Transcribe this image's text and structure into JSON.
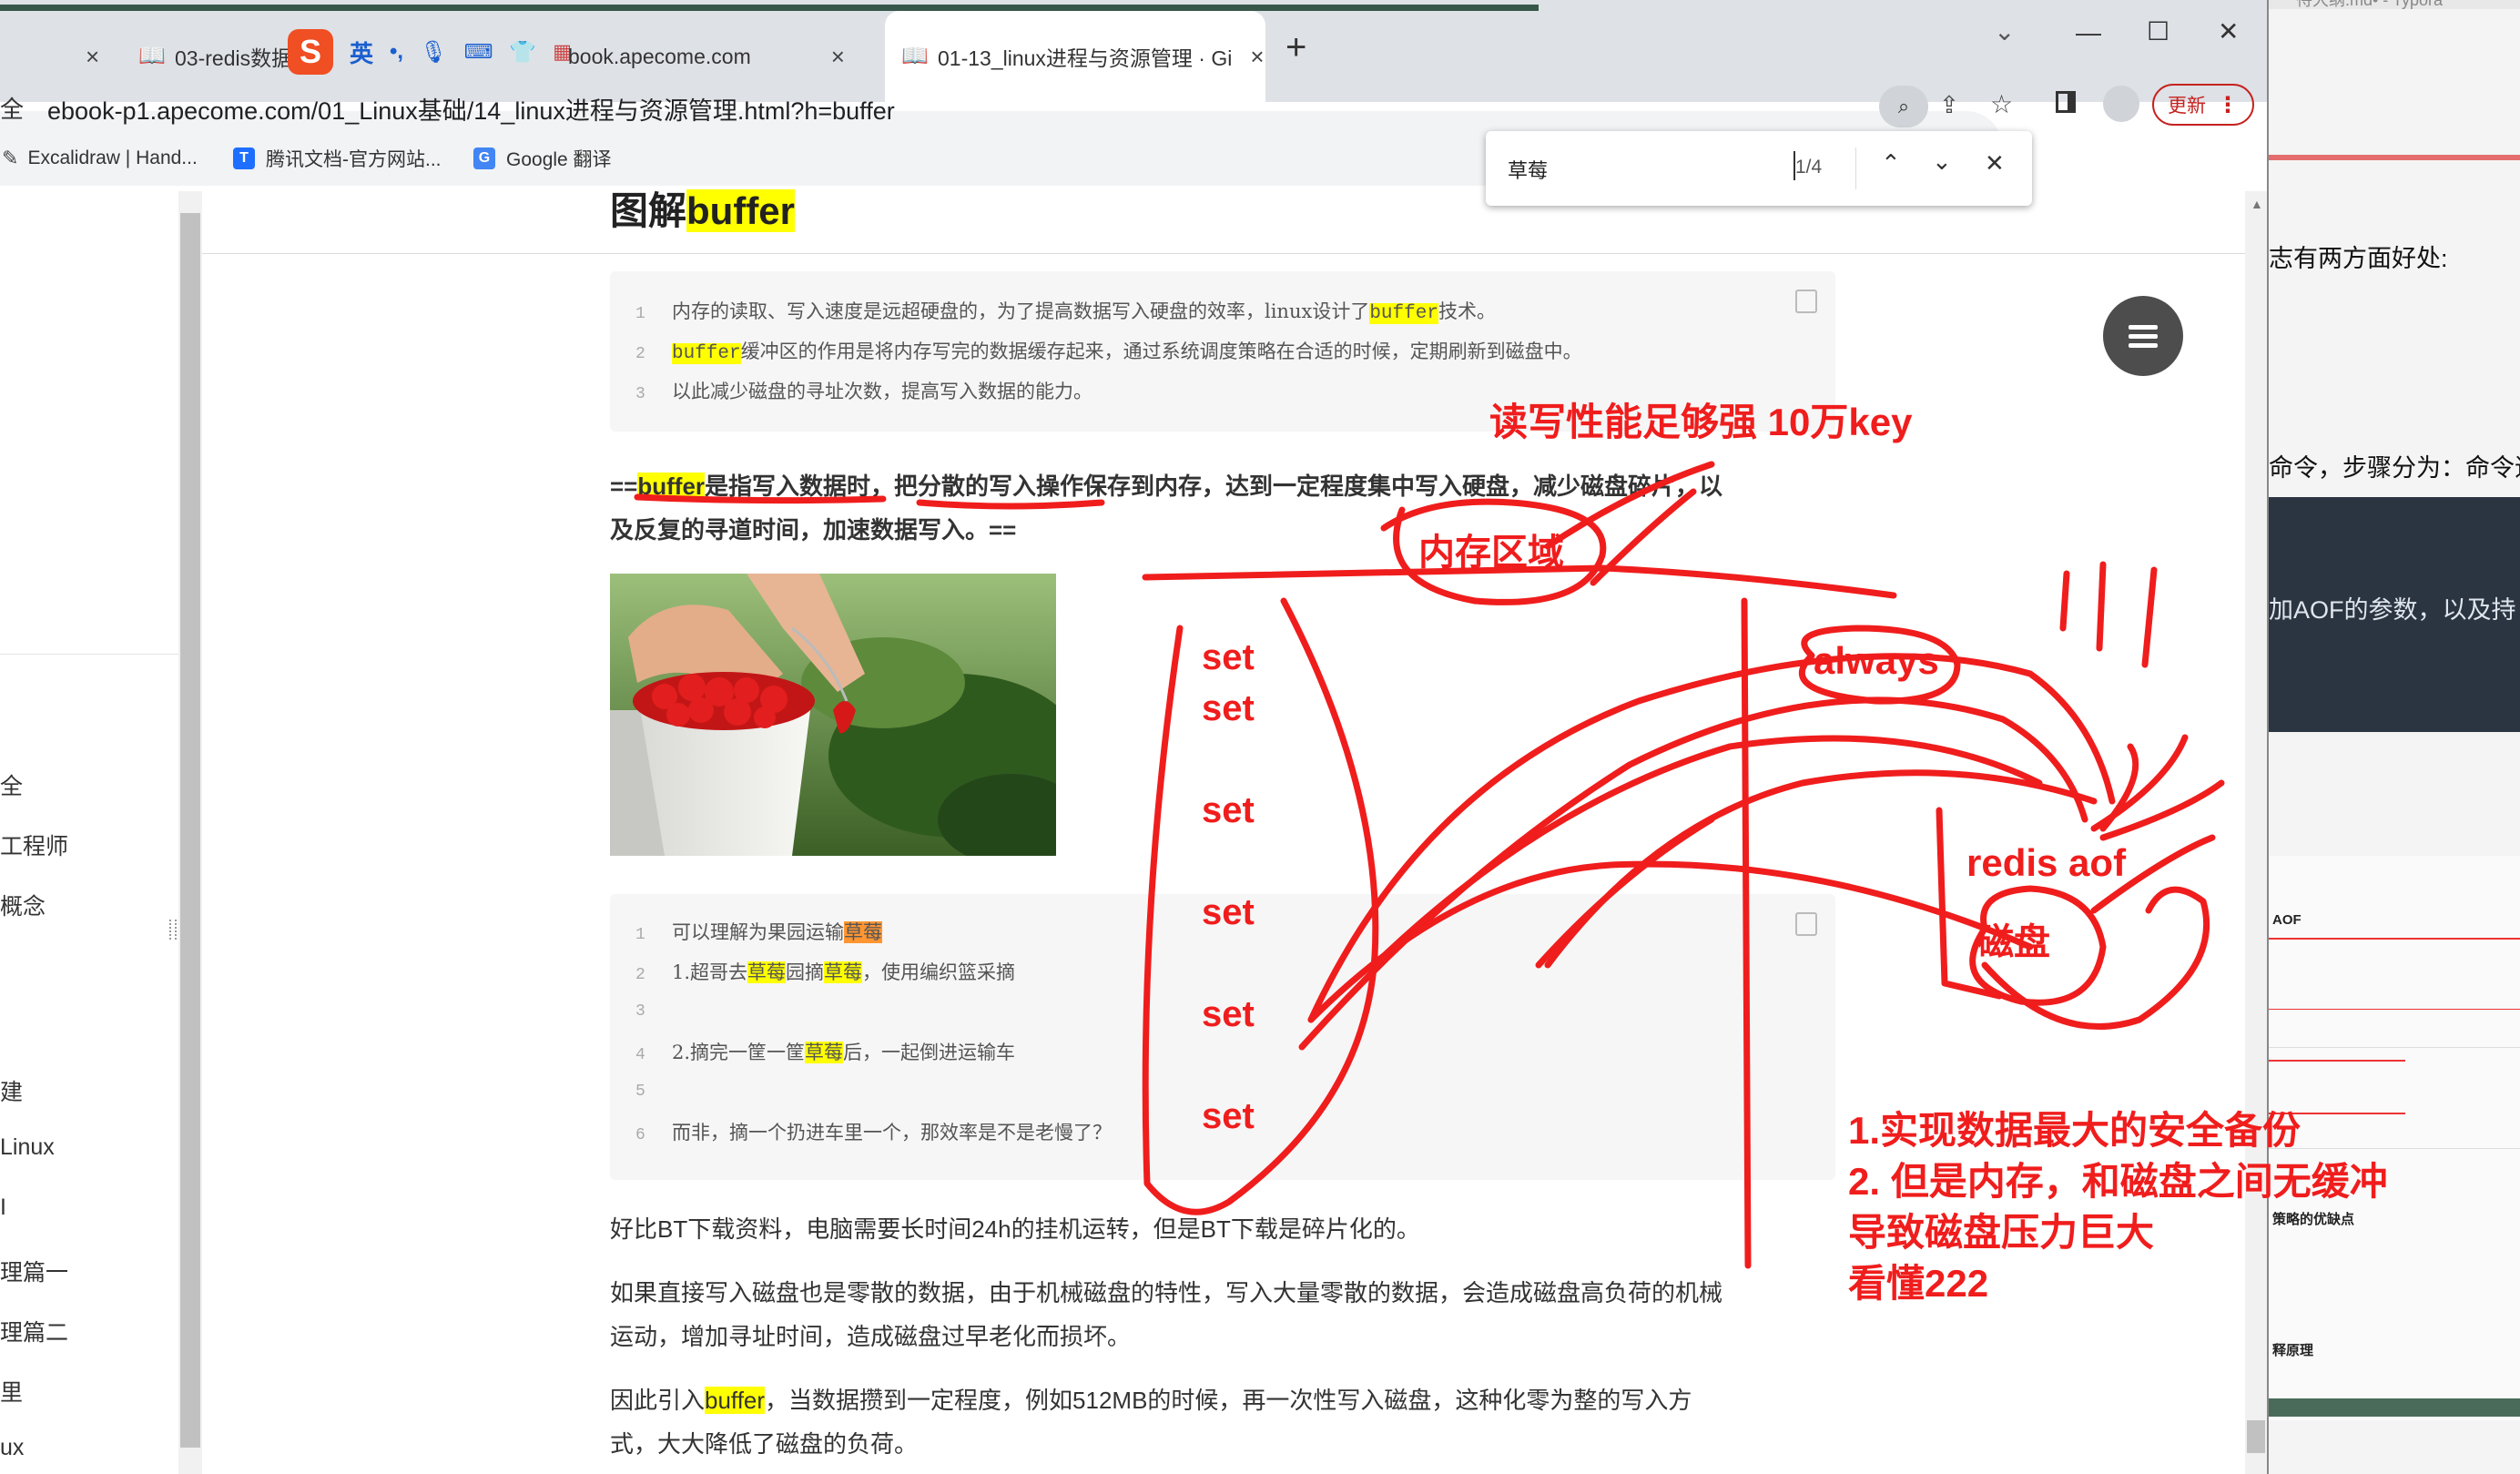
{
  "tabs": [
    {
      "title": "03-redis数据",
      "close": "×"
    },
    {
      "title": "book.apecome.com",
      "close": "×"
    },
    {
      "title": "01-13_linux进程与资源管理 · Gi",
      "close": "×"
    }
  ],
  "left_edge_tab_close": "×",
  "new_tab": "+",
  "ime": {
    "sogou": "S",
    "lang": "英",
    "punct": "•,"
  },
  "window_controls": {
    "dropdown": "⌄",
    "minimize": "—",
    "maximize": "☐",
    "close": "✕"
  },
  "address": {
    "prefix": "全",
    "url": "ebook-p1.apecome.com/01_Linux基础/14_linux进程与资源管理.html?h=buffer"
  },
  "update_button": "更新",
  "bookmarks": [
    "Excalidraw | Hand...",
    "腾讯文档-官方网站...",
    "Google 翻译"
  ],
  "find": {
    "query": "草莓",
    "count": "1/4"
  },
  "sidebar_items": [
    "全",
    "工程师",
    "概念",
    "建",
    "Linux",
    "I",
    "理篇一",
    "理篇二",
    "里",
    "ux"
  ],
  "article": {
    "title_plain": "图解",
    "title_hl": "buffer",
    "code1": [
      {
        "n": "1",
        "pre": "内存的读取、写入速度是远超硬盘的，为了提高数据写入硬盘的效率，linux设计了",
        "hl": "buffer",
        "post": "技术。"
      },
      {
        "n": "2",
        "pre": "",
        "hl": "buffer",
        "post": "缓冲区的作用是将内存写完的数据缓存起来，通过系统调度策略在合适的时候，定期刷新到磁盘中。"
      },
      {
        "n": "3",
        "pre": "以此减少磁盘的寻址次数，提高写入数据的能力。",
        "hl": "",
        "post": ""
      }
    ],
    "bold_para": {
      "line1_pre": "==",
      "line1_hl": "buffer",
      "line1_post": "是指写入数据时，把分散的写入操作保存到内存，达到一定程度集中写入硬盘，减少磁盘碎片，以",
      "line2": "及反复的寻道时间，加速数据写入。=="
    },
    "code2": [
      {
        "n": "1",
        "parts": [
          {
            "t": "可以理解为果园运输"
          },
          {
            "t": "草莓",
            "hl": "orange"
          }
        ]
      },
      {
        "n": "2",
        "parts": [
          {
            "t": "1.超哥去"
          },
          {
            "t": "草莓",
            "hl": "yellow"
          },
          {
            "t": "园摘"
          },
          {
            "t": "草莓",
            "hl": "yellow"
          },
          {
            "t": "，使用编织篮采摘"
          }
        ]
      },
      {
        "n": "3",
        "parts": []
      },
      {
        "n": "4",
        "parts": [
          {
            "t": "2.摘完一筐一筐"
          },
          {
            "t": "草莓",
            "hl": "yellow"
          },
          {
            "t": "后，一起倒进运输车"
          }
        ]
      },
      {
        "n": "5",
        "parts": []
      },
      {
        "n": "6",
        "parts": [
          {
            "t": "而非，摘一个扔进车里一个，那效率是不是老慢了？"
          }
        ]
      }
    ],
    "para1": "好比BT下载资料，电脑需要长时间24h的挂机运转，但是BT下载是碎片化的。",
    "para2_l1": "如果直接写入磁盘也是零散的数据，由于机械磁盘的特性，写入大量零散的数据，会造成磁盘高负荷的机械",
    "para2_l2": "运动，增加寻址时间，造成磁盘过早老化而损坏。",
    "para3_pre": "因此引入",
    "para3_hl": "buffer",
    "para3_post": "，当数据攒到一定程度，例如512MB的时候，再一次性写入磁盘，这种化零为整的写入方",
    "para3_l2": "式，大大降低了磁盘的负荷。"
  },
  "right_window": {
    "title": "待大纲.md• - Typora",
    "line1": "志有两方面好处:",
    "line2": "命令，步骤分为：命令追加",
    "line3": "加AOF的参数，以及持",
    "thumb_labels": [
      "AOF",
      "策略的优缺点",
      "释原理"
    ]
  },
  "annotations": {
    "perf": "读写性能足够强 10万key",
    "memory": "内存区域",
    "sets": [
      "set",
      "set",
      "set",
      "set",
      "set",
      "set"
    ],
    "always": "always",
    "aof": "redis aof",
    "disk": "磁盘",
    "notes": [
      "1.实现数据最大的安全备份",
      "2. 但是内存，和磁盘之间无缓冲",
      "导致磁盘压力巨大",
      "看懂222"
    ]
  },
  "colors": {
    "annotation_red": "#f01d1d",
    "highlight_yellow": "#ffff00",
    "highlight_orange": "#ff9632",
    "update_red": "#c5221f"
  }
}
